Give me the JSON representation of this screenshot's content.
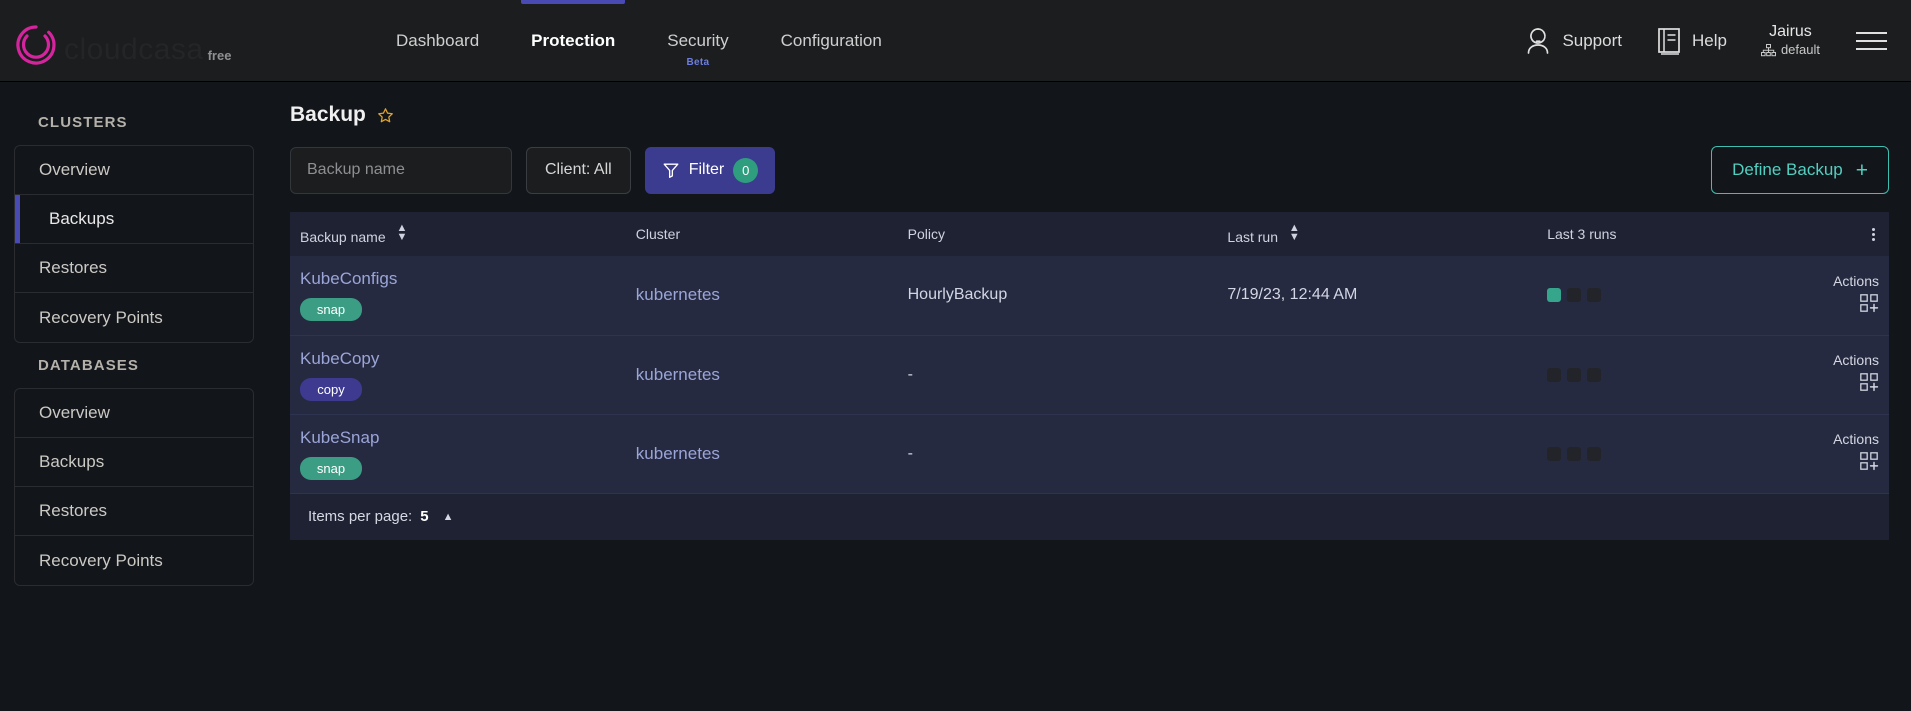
{
  "brand": {
    "name": "cloudcasa",
    "plan": "free",
    "logo_icon": "cloudcasa-ring-logo"
  },
  "nav": {
    "items": [
      {
        "label": "Dashboard",
        "active": false,
        "badge": ""
      },
      {
        "label": "Protection",
        "active": true,
        "badge": ""
      },
      {
        "label": "Security",
        "active": false,
        "badge": "Beta"
      },
      {
        "label": "Configuration",
        "active": false,
        "badge": ""
      }
    ]
  },
  "topright": {
    "support_label": "Support",
    "support_icon": "support-person-icon",
    "help_label": "Help",
    "help_icon": "book-icon",
    "user_name": "Jairus",
    "user_org": "default",
    "org_icon": "org-tree-icon",
    "menu_icon": "hamburger-menu-icon"
  },
  "sidebar": {
    "groups": [
      {
        "title": "CLUSTERS",
        "items": [
          {
            "label": "Overview",
            "active": false
          },
          {
            "label": "Backups",
            "active": true
          },
          {
            "label": "Restores",
            "active": false
          },
          {
            "label": "Recovery Points",
            "active": false
          }
        ]
      },
      {
        "title": "DATABASES",
        "items": [
          {
            "label": "Overview",
            "active": false
          },
          {
            "label": "Backups",
            "active": false
          },
          {
            "label": "Restores",
            "active": false
          },
          {
            "label": "Recovery Points",
            "active": false
          }
        ]
      }
    ]
  },
  "page": {
    "title": "Backup",
    "favorite_icon": "star-outline-icon"
  },
  "toolbar": {
    "search_placeholder": "Backup name",
    "search_value": "",
    "client_label": "Client: All",
    "filter_label": "Filter",
    "filter_icon": "funnel-icon",
    "filter_count": "0",
    "define_label": "Define Backup",
    "define_plus": "+"
  },
  "table": {
    "columns": [
      {
        "label": "Backup name",
        "sortable": true
      },
      {
        "label": "Cluster",
        "sortable": false
      },
      {
        "label": "Policy",
        "sortable": false
      },
      {
        "label": "Last run",
        "sortable": true
      },
      {
        "label": "Last 3 runs",
        "sortable": false
      },
      {
        "label": "",
        "sortable": false
      }
    ],
    "column_menu_icon": "vertical-dots-icon",
    "rows": [
      {
        "name": "KubeConfigs",
        "type_badge": "snap",
        "badge_kind": "snap",
        "cluster": "kubernetes",
        "policy": "HourlyBackup",
        "last_run": "7/19/23, 12:44 AM",
        "runs": [
          "ok",
          "none",
          "none"
        ],
        "actions_label": "Actions",
        "actions_icon": "grid-plus-icon"
      },
      {
        "name": "KubeCopy",
        "type_badge": "copy",
        "badge_kind": "copy",
        "cluster": "kubernetes",
        "policy": "-",
        "last_run": "",
        "runs": [
          "none",
          "none",
          "none"
        ],
        "actions_label": "Actions",
        "actions_icon": "grid-plus-icon"
      },
      {
        "name": "KubeSnap",
        "type_badge": "snap",
        "badge_kind": "snap",
        "cluster": "kubernetes",
        "policy": "-",
        "last_run": "",
        "runs": [
          "none",
          "none",
          "none"
        ],
        "actions_label": "Actions",
        "actions_icon": "grid-plus-icon"
      }
    ]
  },
  "footer": {
    "items_per_page_label": "Items per page:",
    "items_per_page_value": "5",
    "caret_icon": "caret-up-icon"
  },
  "colors": {
    "accent_purple": "#3b3b8f",
    "accent_teal": "#3fbfb0",
    "brand_magenta": "#d6249f",
    "badge_snap": "#3a9d84",
    "badge_copy": "#3d3a8f",
    "row_bg": "#262a40",
    "header_bg": "#1e2233",
    "page_bg": "#12151a"
  }
}
